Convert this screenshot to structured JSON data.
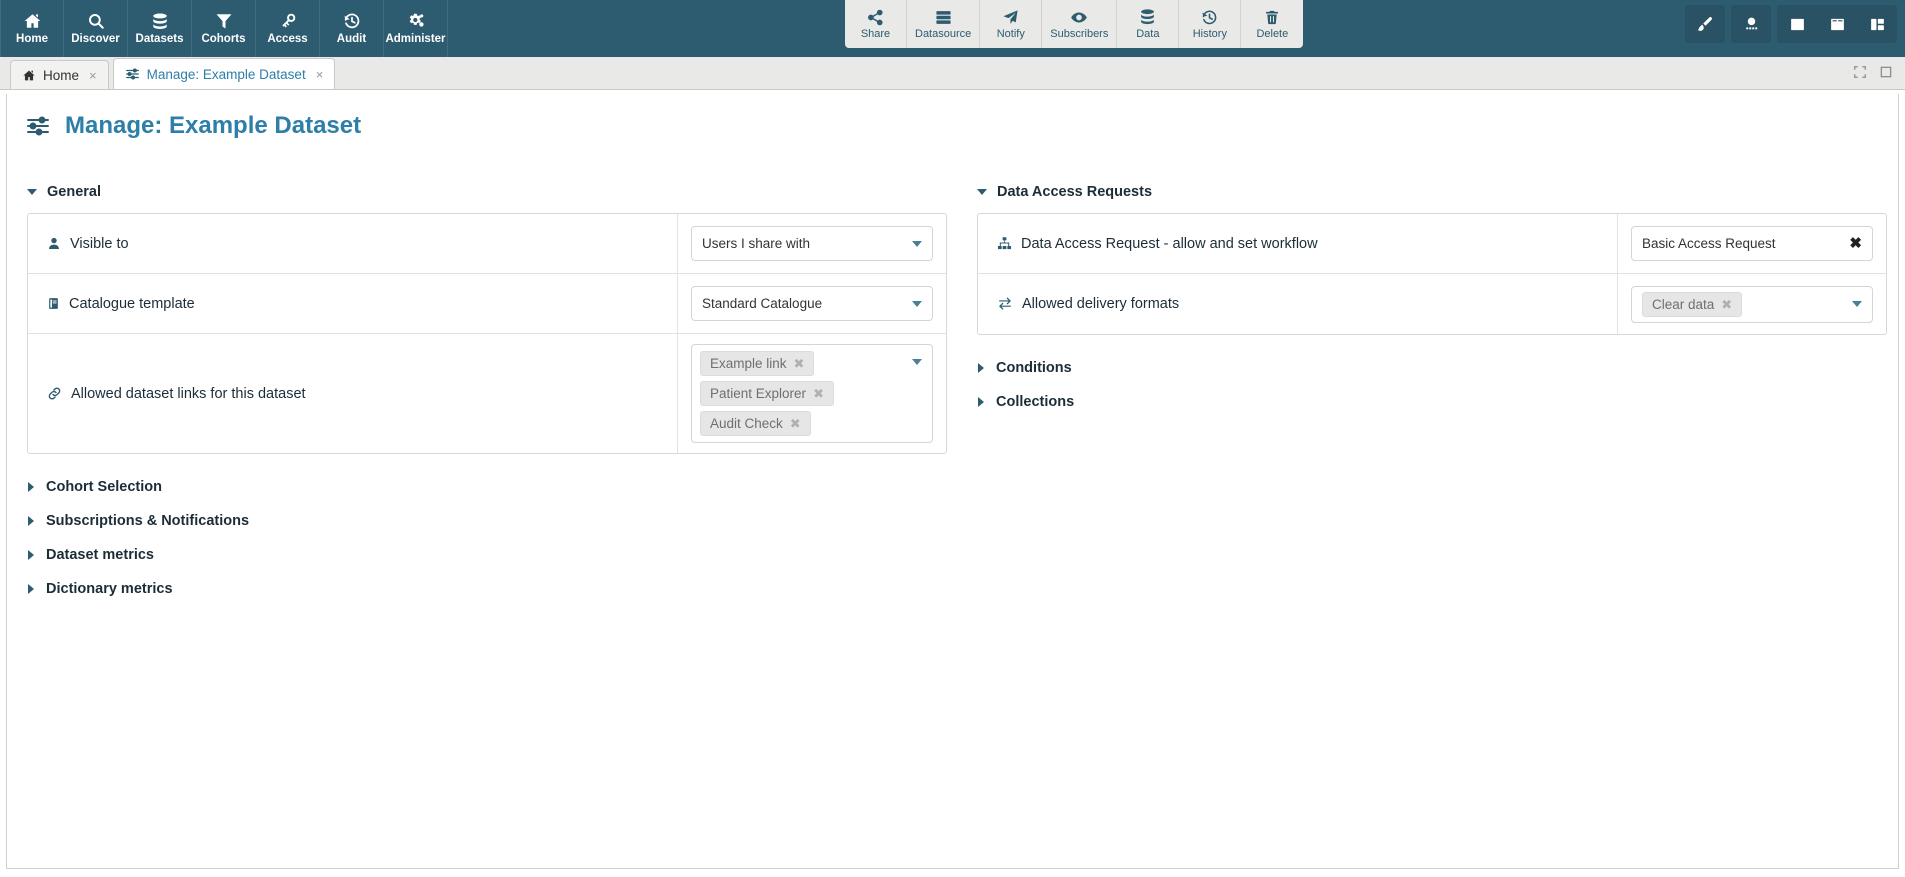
{
  "header": {
    "nav_items": [
      {
        "label": "Home",
        "icon": "home-icon"
      },
      {
        "label": "Discover",
        "icon": "search-icon"
      },
      {
        "label": "Datasets",
        "icon": "database-icon"
      },
      {
        "label": "Cohorts",
        "icon": "filter-icon"
      },
      {
        "label": "Access",
        "icon": "key-icon"
      },
      {
        "label": "Audit",
        "icon": "history-icon"
      },
      {
        "label": "Administer",
        "icon": "gears-icon"
      }
    ],
    "center_items": [
      {
        "label": "Share",
        "icon": "share-icon"
      },
      {
        "label": "Datasource",
        "icon": "server-icon"
      },
      {
        "label": "Notify",
        "icon": "paper-plane-icon"
      },
      {
        "label": "Subscribers",
        "icon": "eye-icon"
      },
      {
        "label": "Data",
        "icon": "database-icon"
      },
      {
        "label": "History",
        "icon": "history-icon"
      },
      {
        "label": "Delete",
        "icon": "trash-icon"
      }
    ],
    "right_items": [
      {
        "icon": "paint-brush-icon"
      },
      {
        "icon": "user-avatar-icon"
      },
      {
        "icon": "layout-single-icon"
      },
      {
        "icon": "layout-window-icon"
      },
      {
        "icon": "layout-split-icon"
      }
    ]
  },
  "tabs": [
    {
      "label": "Home",
      "icon": "home-icon",
      "active": false,
      "close": "×"
    },
    {
      "label": "Manage: Example Dataset",
      "icon": "sliders-icon",
      "active": true,
      "close": "×"
    }
  ],
  "tabbar_controls": [
    {
      "icon": "expand-icon"
    },
    {
      "icon": "maximize-icon"
    }
  ],
  "page": {
    "title": "Manage: Example Dataset",
    "title_icon": "sliders-icon"
  },
  "left_column": {
    "general": {
      "heading": "General",
      "expanded": true,
      "rows": [
        {
          "label": "Visible to",
          "icon": "user-icon",
          "control": "select",
          "value": "Users I share with"
        },
        {
          "label": "Catalogue template",
          "icon": "book-icon",
          "control": "select",
          "value": "Standard Catalogue"
        },
        {
          "label": "Allowed dataset links for this dataset",
          "icon": "link-icon",
          "control": "multiselect",
          "chips": [
            "Example link",
            "Patient Explorer",
            "Audit Check"
          ]
        }
      ]
    },
    "collapsed_sections": [
      {
        "label": "Cohort Selection"
      },
      {
        "label": "Subscriptions & Notifications"
      },
      {
        "label": "Dataset metrics"
      },
      {
        "label": "Dictionary metrics"
      }
    ]
  },
  "right_column": {
    "data_access_requests": {
      "heading": "Data Access Requests",
      "expanded": true,
      "rows": [
        {
          "label": "Data Access Request - allow and set workflow",
          "icon": "sitemap-icon",
          "control": "select-clearable",
          "value": "Basic Access Request",
          "clear": "✖"
        },
        {
          "label": "Allowed delivery formats",
          "icon": "exchange-icon",
          "control": "multiselect",
          "chips": [
            "Clear data"
          ]
        }
      ]
    },
    "collapsed_sections": [
      {
        "label": "Conditions"
      },
      {
        "label": "Collections"
      }
    ]
  },
  "colors": {
    "header_bg": "#2d5c70",
    "accent": "#2d7fa8",
    "icon_teal": "#2d5c70",
    "chip_bg": "#e6e6e6",
    "tabbar_bg": "#e9e9e7"
  }
}
